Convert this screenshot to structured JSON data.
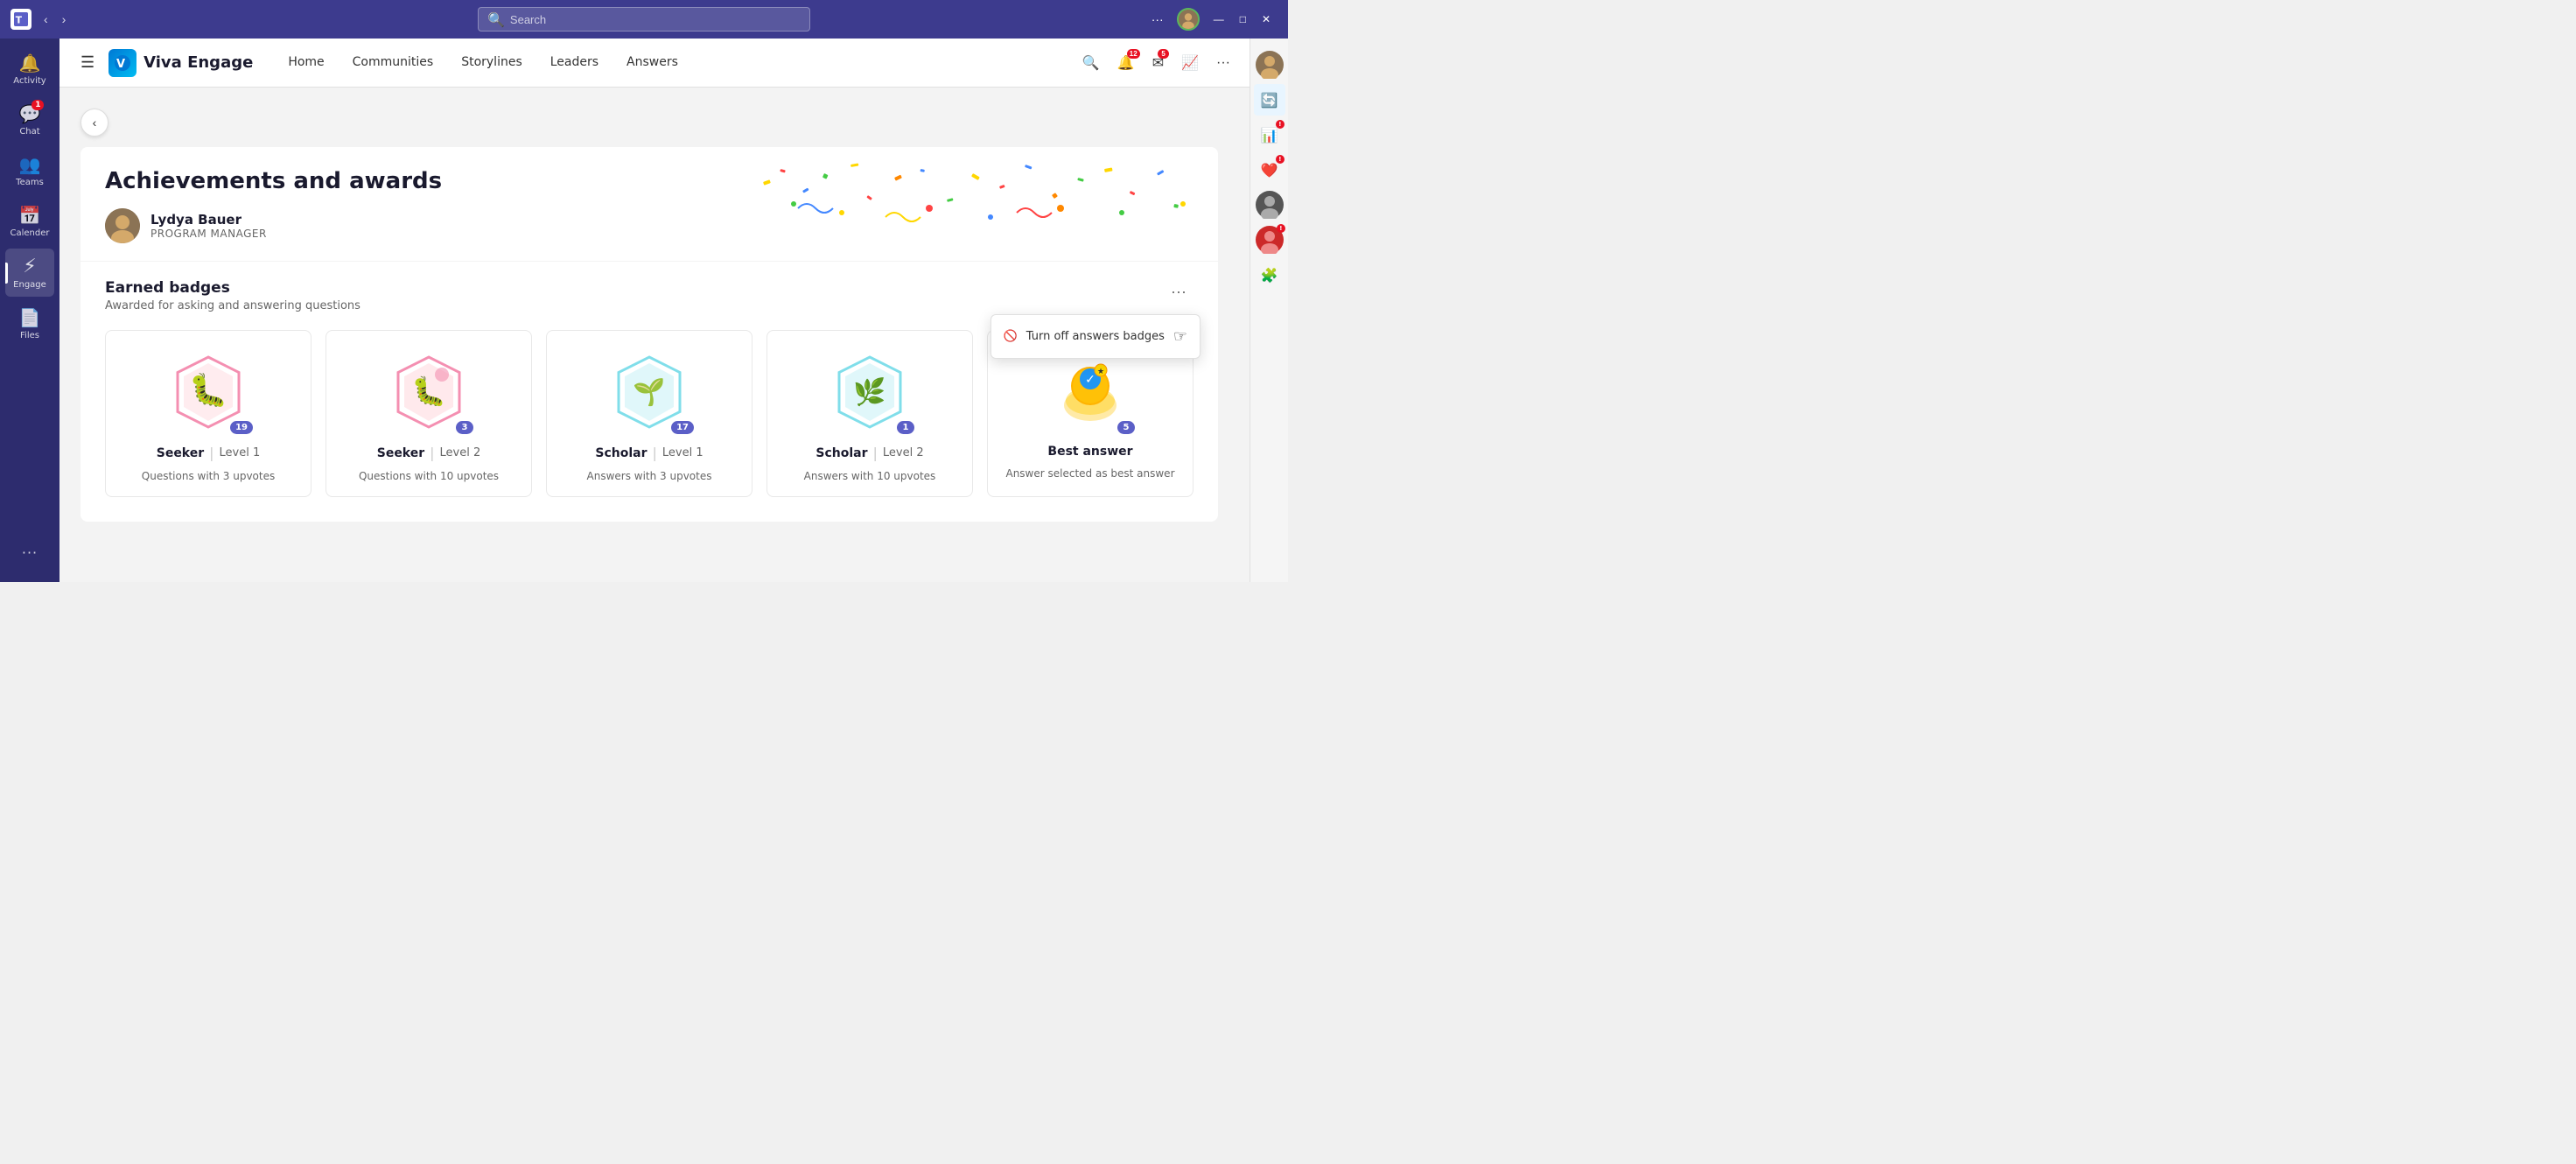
{
  "titleBar": {
    "searchPlaceholder": "Search",
    "moreLabel": "···",
    "minimizeLabel": "—",
    "maximizeLabel": "□",
    "closeLabel": "✕"
  },
  "sidebar": {
    "items": [
      {
        "label": "Activity",
        "icon": "🔔",
        "badge": null
      },
      {
        "label": "Chat",
        "icon": "💬",
        "badge": "1"
      },
      {
        "label": "Teams",
        "icon": "👥",
        "badge": null
      },
      {
        "label": "Calender",
        "icon": "📅",
        "badge": null
      },
      {
        "label": "Engage",
        "icon": "⚡",
        "badge": null
      },
      {
        "label": "Files",
        "icon": "📄",
        "badge": null
      }
    ],
    "moreLabel": "···"
  },
  "engageHeader": {
    "logoText": "Viva Engage",
    "nav": [
      {
        "label": "Home",
        "active": false
      },
      {
        "label": "Communities",
        "active": false
      },
      {
        "label": "Storylines",
        "active": false
      },
      {
        "label": "Leaders",
        "active": false
      },
      {
        "label": "Answers",
        "active": false
      }
    ],
    "actions": {
      "searchLabel": "🔍",
      "notifLabel": "🔔",
      "notifBadge": "12",
      "msgLabel": "✉",
      "msgBadge": "5",
      "analyticsLabel": "📊",
      "moreLabel": "···"
    }
  },
  "page": {
    "title": "Achievements and awards",
    "backLabel": "‹",
    "user": {
      "name": "Lydya Bauer",
      "role": "PROGRAM MANAGER"
    }
  },
  "badgesSection": {
    "title": "Earned badges",
    "subtitle": "Awarded for asking and answering questions",
    "moreOptionsLabel": "···",
    "dropdown": {
      "visible": true,
      "items": [
        {
          "label": "Turn off answers badges",
          "icon": "🚫"
        }
      ]
    },
    "badges": [
      {
        "name": "Seeker",
        "level": "Level 1",
        "description": "Questions with 3 upvotes",
        "count": "19",
        "color": "#e91e8c",
        "type": "seeker1"
      },
      {
        "name": "Seeker",
        "level": "Level 2",
        "description": "Questions with 10 upvotes",
        "count": "3",
        "color": "#e91e8c",
        "type": "seeker2"
      },
      {
        "name": "Scholar",
        "level": "Level 1",
        "description": "Answers with 3 upvotes",
        "count": "17",
        "color": "#00bcd4",
        "type": "scholar1"
      },
      {
        "name": "Scholar",
        "level": "Level 2",
        "description": "Answers with 10 upvotes",
        "count": "1",
        "color": "#00bcd4",
        "type": "scholar2"
      },
      {
        "name": "Best answer",
        "level": "",
        "description": "Answer selected as best answer",
        "count": "5",
        "color": "#ff9800",
        "type": "bestanswer"
      }
    ]
  },
  "rightRail": {
    "avatarColors": [
      "#8b7355",
      "#0078d4",
      "#cc2929",
      "#9b59b6",
      "#cc2929",
      "#888"
    ]
  }
}
